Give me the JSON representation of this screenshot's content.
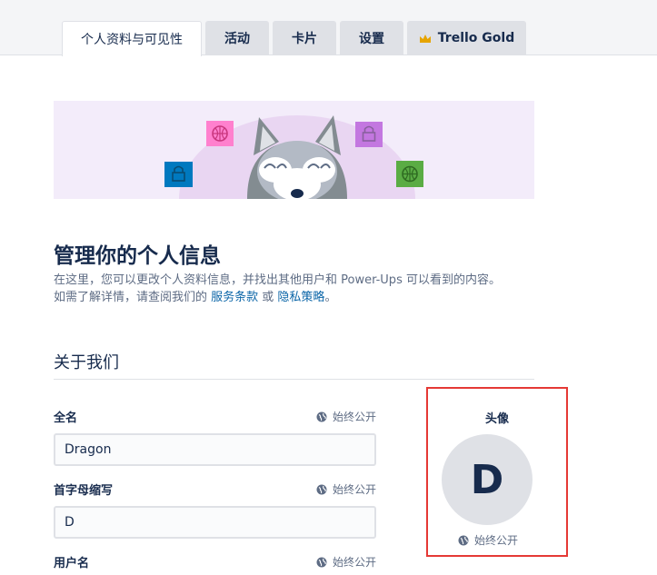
{
  "tabs": [
    {
      "label": "个人资料与可见性",
      "active": true
    },
    {
      "label": "活动",
      "active": false
    },
    {
      "label": "卡片",
      "active": false
    },
    {
      "label": "设置",
      "active": false
    },
    {
      "label": "Trello Gold",
      "active": false,
      "icon": "crown-icon"
    }
  ],
  "header": {
    "title": "管理你的个人信息",
    "desc_line1": "在这里，您可以更改个人资料信息，并找出其他用户和 Power-Ups 可以看到的内容。",
    "desc_line2_prefix": "如需了解详情，请查阅我们的 ",
    "terms_link": "服务条款",
    "desc_or": " 或 ",
    "privacy_link": "隐私策略",
    "desc_end": "。"
  },
  "section": {
    "title": "关于我们"
  },
  "fields": {
    "fullname": {
      "label": "全名",
      "value": "Dragon",
      "visibility": "始终公开"
    },
    "initials": {
      "label": "首字母缩写",
      "value": "D",
      "visibility": "始终公开"
    },
    "username": {
      "label": "用户名",
      "visibility": "始终公开"
    }
  },
  "avatar": {
    "title": "头像",
    "initial": "D",
    "visibility": "始终公开"
  },
  "colors": {
    "accent_link": "#0c66a8",
    "highlight_border": "#e53935",
    "tab_bg": "#dfe1e6",
    "hero_bg": "#f3ecfa"
  }
}
